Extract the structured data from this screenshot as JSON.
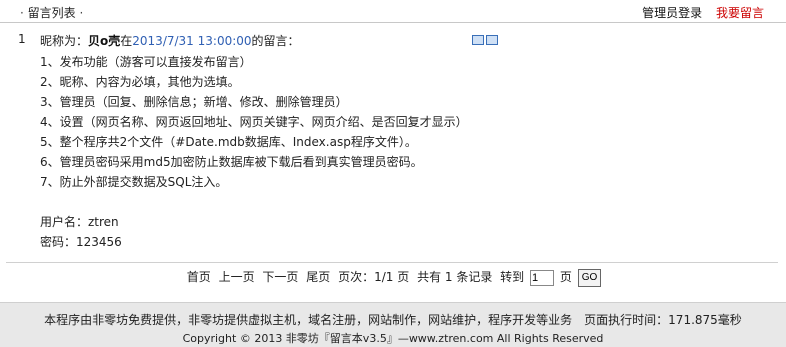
{
  "header": {
    "dot": "·",
    "title": "留言列表",
    "admin_login": "管理员登录",
    "post_message": "我要留言"
  },
  "message": {
    "index": "1",
    "nick_prefix": "昵称为：",
    "author": "贝o壳",
    "at": "在",
    "time": "2013/7/31 13:00:00",
    "suffix": "的留言：",
    "lines": [
      "1、发布功能（游客可以直接发布留言）",
      "2、昵称、内容为必填，其他为选填。",
      "3、管理员（回复、删除信息；新增、修改、删除管理员）",
      "4、设置（网页名称、网页返回地址、网页关键字、网页介绍、是否回复才显示）",
      "5、整个程序共2个文件（#Date.mdb数据库、Index.asp程序文件）。",
      "6、管理员密码采用md5加密防止数据库被下载后看到真实管理员密码。",
      "7、防止外部提交数据及SQL注入。",
      "",
      "用户名：ztren",
      "密码：123456"
    ]
  },
  "pager": {
    "first": "首页",
    "prev": "上一页",
    "next": "下一页",
    "last": "尾页",
    "pages_label": "页次：1/1 页",
    "total": "共有 1 条记录",
    "goto": "转到",
    "page_value": "1",
    "page_unit": "页",
    "go": "GO"
  },
  "footer": {
    "line1": "本程序由非零坊免费提供，非零坊提供虚拟主机，域名注册，网站制作，网站维护，程序开发等业务　页面执行时间：171.875毫秒",
    "line2": "Copyright © 2013 非零坊『留言本v3.5』—www.ztren.com All Rights Reserved"
  }
}
